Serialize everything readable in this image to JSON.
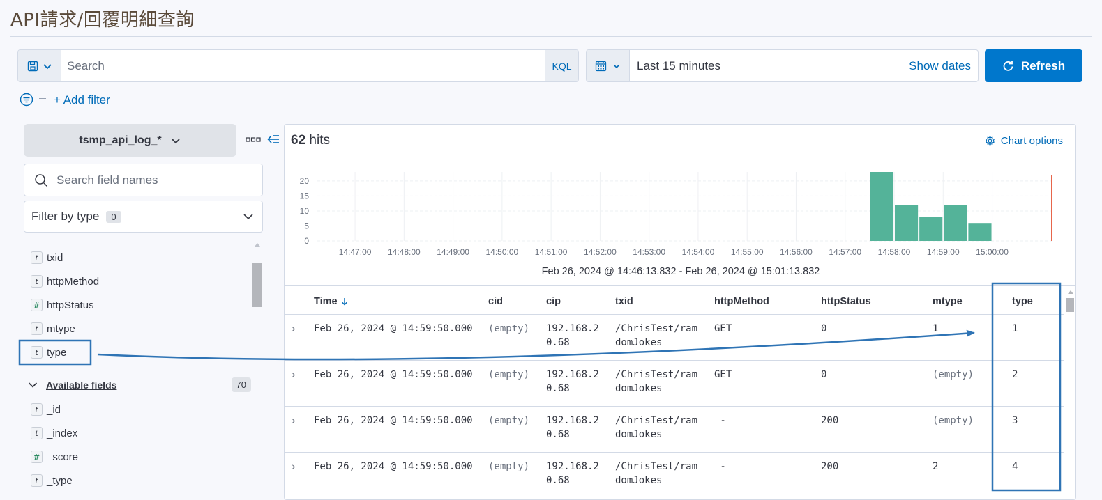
{
  "page": {
    "title": "API請求/回覆明細查詢"
  },
  "query": {
    "placeholder": "Search",
    "language_label": "KQL"
  },
  "date_picker": {
    "range": "Last 15 minutes",
    "show_dates_label": "Show dates"
  },
  "refresh": {
    "label": "Refresh"
  },
  "filters": {
    "add_label": "+ Add filter"
  },
  "sidebar": {
    "index_pattern": "tsmp_api_log_*",
    "search_placeholder": "Search field names",
    "filter_by_type_label": "Filter by type",
    "filter_count": "0",
    "selected_fields": [
      {
        "name": "txid",
        "type": "t"
      },
      {
        "name": "httpMethod",
        "type": "t"
      },
      {
        "name": "httpStatus",
        "type": "#"
      },
      {
        "name": "mtype",
        "type": "t"
      },
      {
        "name": "type",
        "type": "t"
      }
    ],
    "available_label": "Available fields",
    "available_count": "70",
    "available_fields": [
      {
        "name": "_id",
        "type": "t"
      },
      {
        "name": "_index",
        "type": "t"
      },
      {
        "name": "_score",
        "type": "#"
      },
      {
        "name": "_type",
        "type": "t"
      }
    ]
  },
  "main": {
    "hits_count": "62",
    "hits_label": "hits",
    "chart_options_label": "Chart options",
    "time_range_text": "Feb 26, 2024 @ 14:46:13.832 - Feb 26, 2024 @ 15:01:13.832"
  },
  "chart_data": {
    "type": "bar",
    "title": "",
    "xlabel": "",
    "ylabel": "",
    "ylim": [
      0,
      23
    ],
    "y_ticks": [
      "0",
      "5",
      "10",
      "15",
      "20"
    ],
    "x_ticks": [
      "14:47:00",
      "14:48:00",
      "14:49:00",
      "14:50:00",
      "14:51:00",
      "14:52:00",
      "14:53:00",
      "14:54:00",
      "14:55:00",
      "14:56:00",
      "14:57:00",
      "14:58:00",
      "14:59:00",
      "15:00:00"
    ],
    "categories": [
      "14:57:30",
      "14:58:00",
      "14:58:30",
      "14:59:00",
      "14:59:30"
    ],
    "values": [
      23,
      12,
      8,
      12,
      6
    ],
    "bar_color": "#54b399",
    "now_marker_color": "#e7664c",
    "grid": true
  },
  "table": {
    "columns": [
      "Time",
      "cid",
      "cip",
      "txid",
      "httpMethod",
      "httpStatus",
      "mtype",
      "type"
    ],
    "rows": [
      {
        "time": "Feb 26, 2024 @ 14:59:50.000",
        "cid": "(empty)",
        "cip_1": "192.168.2",
        "cip_2": "0.68",
        "txid_1": "/ChrisTest/ram",
        "txid_2": "domJokes",
        "httpMethod": "GET",
        "httpStatus": "0",
        "mtype": "1",
        "type": "1"
      },
      {
        "time": "Feb 26, 2024 @ 14:59:50.000",
        "cid": "(empty)",
        "cip_1": "192.168.2",
        "cip_2": "0.68",
        "txid_1": "/ChrisTest/ram",
        "txid_2": "domJokes",
        "httpMethod": "GET",
        "httpStatus": "0",
        "mtype": "(empty)",
        "type": "2"
      },
      {
        "time": "Feb 26, 2024 @ 14:59:50.000",
        "cid": "(empty)",
        "cip_1": "192.168.2",
        "cip_2": "0.68",
        "txid_1": "/ChrisTest/ram",
        "txid_2": "domJokes",
        "httpMethod": " -",
        "httpStatus": "200",
        "mtype": "(empty)",
        "type": "3"
      },
      {
        "time": "Feb 26, 2024 @ 14:59:50.000",
        "cid": "(empty)",
        "cip_1": "192.168.2",
        "cip_2": "0.68",
        "txid_1": "/ChrisTest/ram",
        "txid_2": "domJokes",
        "httpMethod": " -",
        "httpStatus": "200",
        "mtype": "2",
        "type": "4"
      }
    ]
  },
  "colors": {
    "primary": "#0077cc",
    "link": "#006bb8",
    "annotation": "#2f74b5"
  }
}
